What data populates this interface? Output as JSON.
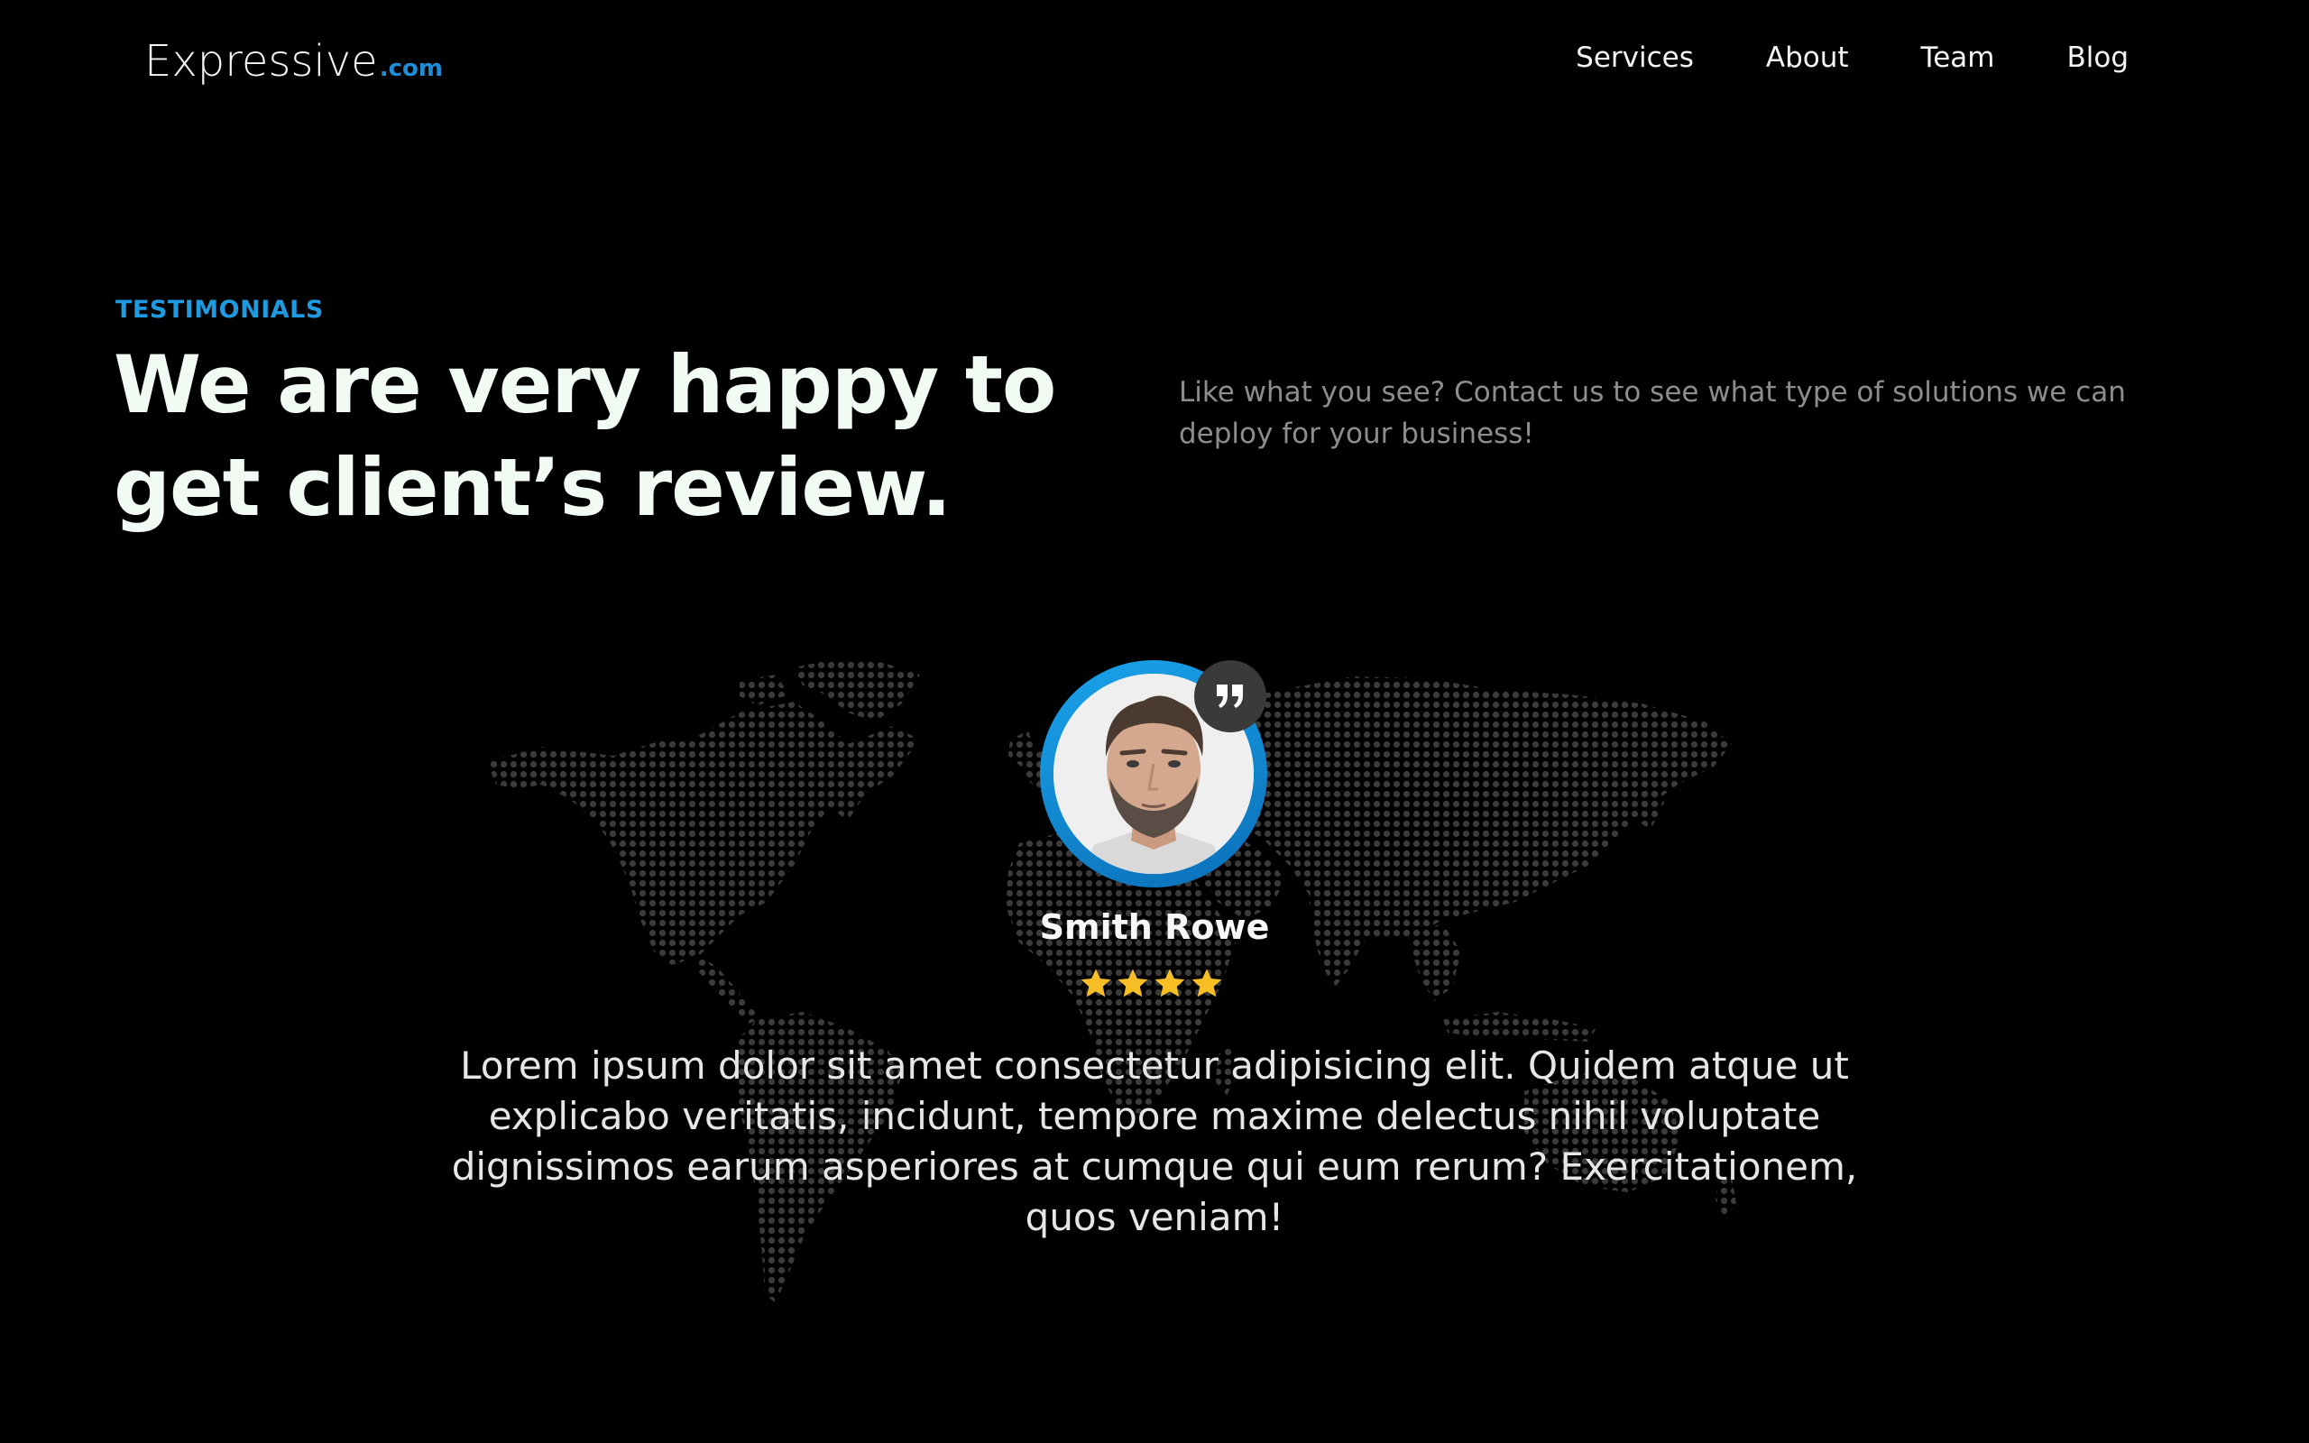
{
  "header": {
    "logo_main": "Expressive",
    "logo_tld": ".com",
    "nav": [
      "Services",
      "About",
      "Team",
      "Blog"
    ]
  },
  "section": {
    "eyebrow": "TESTIMONIALS",
    "headline_line1": "We are very happy to",
    "headline_line2": "get client’s review.",
    "intro": "Like what you see? Contact us to see what type of solutions we can deploy for your business!"
  },
  "testimonial": {
    "name": "Smith Rowe",
    "rating": 4,
    "review": "Lorem ipsum dolor sit amet consectetur adipisicing elit. Quidem atque ut explicabo veritatis, incidunt, tempore maxime delectus nihil voluptate dignissimos earum asperiores at cumque qui eum rerum? Exercitationem, quos veniam!"
  },
  "colors": {
    "background": "#000000",
    "accent": "#1e9be0",
    "star": "#f7be25",
    "map_dots": "#3a3a3a"
  },
  "icons": [
    "quote-icon",
    "star-icon",
    "world-map"
  ]
}
